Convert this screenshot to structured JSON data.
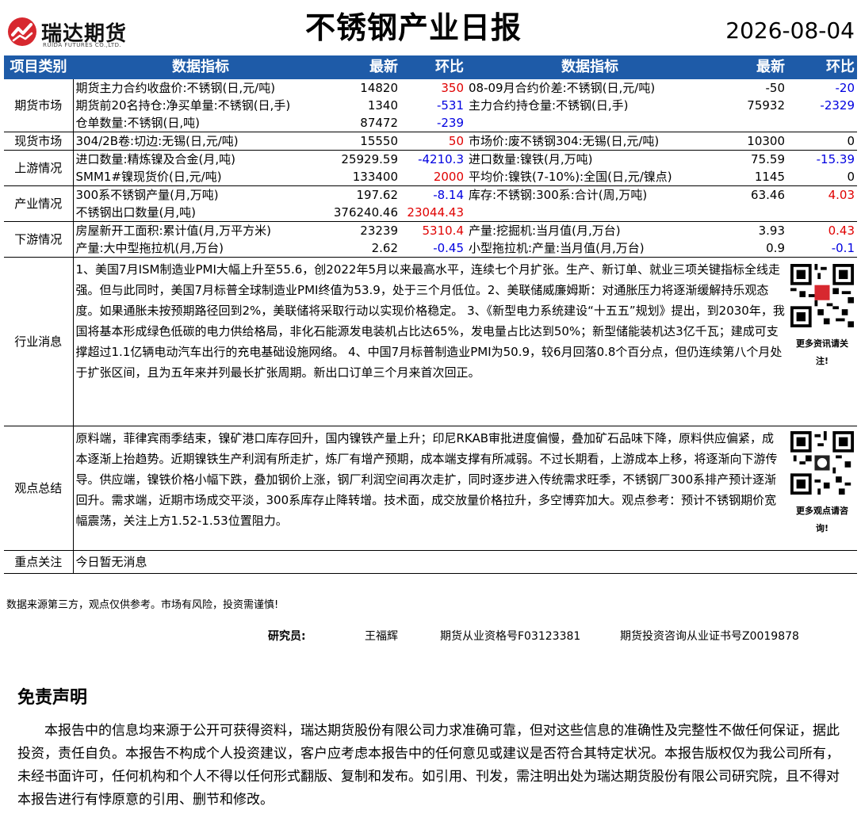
{
  "header": {
    "logo_cn": "瑞达期货",
    "logo_en": "RUIDA FUTURES CO.,LTD.",
    "title": "不锈钢产业日报",
    "date": "2026-08-04"
  },
  "table_head": [
    "项目类别",
    "数据指标",
    "最新",
    "环比",
    "数据指标",
    "最新",
    "环比"
  ],
  "sections": {
    "futures": {
      "category": "期货市场",
      "rows": [
        {
          "l_name": "期货主力合约收盘价:不锈钢(日,元/吨)",
          "l_val": "14820",
          "l_chg": "350",
          "r_name": "08-09月合约价差:不锈钢(日,元/吨)",
          "r_val": "-50",
          "r_chg": "-20"
        },
        {
          "l_name": "期货前20名持仓:净买单量:不锈钢(日,手)",
          "l_val": "1340",
          "l_chg": "-531",
          "r_name": "主力合约持仓量:不锈钢(日,手)",
          "r_val": "75932",
          "r_chg": "-2329"
        },
        {
          "l_name": "仓单数量:不锈钢(日,吨)",
          "l_val": "87472",
          "l_chg": "-239",
          "r_name": "",
          "r_val": "",
          "r_chg": ""
        }
      ]
    },
    "spot": {
      "category": "现货市场",
      "rows": [
        {
          "l_name": "304/2B卷:切边:无锡(日,元/吨)",
          "l_val": "15550",
          "l_chg": "50",
          "r_name": "市场价:废不锈钢304:无锡(日,元/吨)",
          "r_val": "10300",
          "r_chg": "0"
        }
      ]
    },
    "upstream": {
      "category": "上游情况",
      "rows": [
        {
          "l_name": "进口数量:精炼镍及合金(月,吨)",
          "l_val": "25929.59",
          "l_chg": "-4210.3",
          "r_name": "进口数量:镍铁(月,万吨)",
          "r_val": "75.59",
          "r_chg": "-15.39"
        },
        {
          "l_name": "SMM1#镍现货价(日,元/吨)",
          "l_val": "133400",
          "l_chg": "2000",
          "r_name": "平均价:镍铁(7-10%):全国(日,元/镍点)",
          "r_val": "1145",
          "r_chg": "0"
        }
      ]
    },
    "industry": {
      "category": "产业情况",
      "rows": [
        {
          "l_name": "300系不锈钢产量(月,万吨)",
          "l_val": "197.62",
          "l_chg": "-8.14",
          "r_name": "库存:不锈钢:300系:合计(周,万吨)",
          "r_val": "63.46",
          "r_chg": "4.03"
        },
        {
          "l_name": "不锈钢出口数量(月,吨)",
          "l_val": "376240.46",
          "l_chg": "23044.43",
          "r_name": "",
          "r_val": "",
          "r_chg": ""
        }
      ]
    },
    "downstream": {
      "category": "下游情况",
      "rows": [
        {
          "l_name": "房屋新开工面积:累计值(月,万平方米)",
          "l_val": "23239",
          "l_chg": "5310.4",
          "r_name": "产量:挖掘机:当月值(月,万台)",
          "r_val": "3.93",
          "r_chg": "0.43"
        },
        {
          "l_name": "产量:大中型拖拉机(月,万台)",
          "l_val": "2.62",
          "l_chg": "-0.45",
          "r_name": "小型拖拉机:产量:当月值(月,万台)",
          "r_val": "0.9",
          "r_chg": "-0.1"
        }
      ]
    }
  },
  "news": {
    "category": "行业消息",
    "text": "1、美国7月ISM制造业PMI大幅上升至55.6，创2022年5月以来最高水平，连续七个月扩张。生产、新订单、就业三项关键指标全线走强。但与此同时，美国7月标普全球制造业PMI终值为53.9，处于三个月低位。2、美联储威廉姆斯：对通胀压力将逐渐缓解持乐观态度。如果通胀未按预期路径回到2%，美联储将采取行动以实现价格稳定。 3、《新型电力系统建设“十五五”规划》提出，到2030年，我国将基本形成绿色低碳的电力供给格局，非化石能源发电装机占比达65%，发电量占比达到50%；新型储能装机达3亿千瓦；建成可支撑超过1.1亿辆电动汽车出行的充电基础设施网络。 4、中国7月标普制造业PMI为50.9，较6月回落0.8个百分点，但仍连续第八个月处于扩张区间，且为五年来并列最长扩张周期。新出口订单三个月来首次回正。",
    "qr_caption": "更多资讯请关注!"
  },
  "view": {
    "category": "观点总结",
    "text": "原料端，菲律宾雨季结束，镍矿港口库存回升，国内镍铁产量上升；印尼RKAB审批进度偏慢，叠加矿石品味下降，原料供应偏紧，成本逐渐上抬趋势。近期镍铁生产利润有所走扩，炼厂有增产预期，成本端支撑有所减弱。不过长期看，上游成本上移，将逐渐向下游传导。供应端，镍铁价格小幅下跌，叠加钢价上涨，钢厂利润空间再次走扩，同时逐步进入传统需求旺季，不锈钢厂300系排产预计逐渐回升。需求端，近期市场成交平淡，300系库存止降转增。技术面，成交放量价格拉升，多空博弈加大。观点参考：预计不锈钢期价宽幅震荡，关注上方1.52-1.53位置阻力。",
    "qr_caption": "更多观点请咨询!"
  },
  "focus": {
    "category": "重点关注",
    "text": "今日暂无消息"
  },
  "footnote": "数据来源第三方，观点仅供参考。市场有风险，投资需谨慎!",
  "researcher": {
    "label": "研究员:",
    "name": "王福辉",
    "license1": "期货从业资格号F03123381",
    "license2": "期货投资咨询从业证书号Z0019878"
  },
  "disclaimer": {
    "title": "免责声明",
    "body": "本报告中的信息均来源于公开可获得资料，瑞达期货股份有限公司力求准确可靠，但对这些信息的准确性及完整性不做任何保证，据此投资，责任自负。本报告不构成个人投资建议，客户应考虑本报告中的任何意见或建议是否符合其特定状况。本报告版权仅为我公司所有，未经书面许可，任何机构和个人不得以任何形式翻版、复制和发布。如引用、刊发，需注明出处为瑞达期货股份有限公司研究院，且不得对本报告进行有悖原意的引用、删节和修改。"
  },
  "colors": {
    "header_bg": "#1e5ba8",
    "up": "#e00000",
    "down": "#0000e0",
    "logo_red": "#d7282f"
  }
}
